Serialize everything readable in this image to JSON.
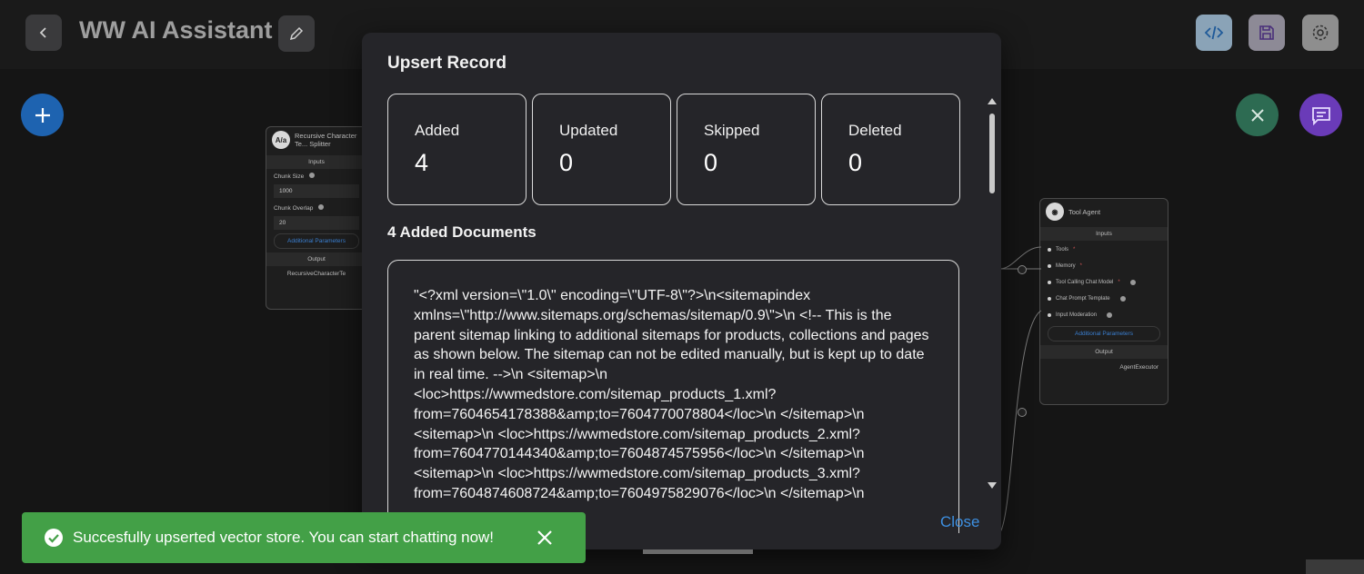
{
  "header": {
    "title": "WW AI Assistant",
    "icons": {
      "back": "chevron-left-icon",
      "edit": "pencil-icon",
      "code": "code-icon",
      "save": "save-icon",
      "settings": "gear-icon"
    }
  },
  "canvas": {
    "splitter_node": {
      "title": "Recursive Character Te... Splitter",
      "icon_text": "A/a",
      "inputs_label": "Inputs",
      "fields": [
        {
          "label": "Chunk Size",
          "value": "1000"
        },
        {
          "label": "Chunk Overlap",
          "value": "20"
        }
      ],
      "additional_params": "Additional Parameters",
      "output_label": "Output",
      "output_value": "RecursiveCharacterTe"
    },
    "agent_node": {
      "title": "Tool Agent",
      "inputs_label": "Inputs",
      "inputs": [
        {
          "label": "Tools",
          "required": "*"
        },
        {
          "label": "Memory",
          "required": "*"
        },
        {
          "label": "Tool Calling Chat Model",
          "required": "*"
        },
        {
          "label": "Chat Prompt Template",
          "required": ""
        },
        {
          "label": "Input Moderation",
          "required": ""
        }
      ],
      "additional_params": "Additional Parameters",
      "output_label": "Output",
      "output_value": "AgentExecutor"
    }
  },
  "dialog": {
    "title": "Upsert Record",
    "stats": [
      {
        "label": "Added",
        "value": "4"
      },
      {
        "label": "Updated",
        "value": "0"
      },
      {
        "label": "Skipped",
        "value": "0"
      },
      {
        "label": "Deleted",
        "value": "0"
      }
    ],
    "documents_title": "4 Added Documents",
    "document_text": "\"<?xml version=\\\"1.0\\\" encoding=\\\"UTF-8\\\"?>\\n<sitemapindex xmlns=\\\"http://www.sitemaps.org/schemas/sitemap/0.9\\\">\\n <!-- This is the parent sitemap linking to additional sitemaps for products, collections and pages as shown below. The sitemap can not be edited manually, but is kept up to date in real time. -->\\n <sitemap>\\n <loc>https://wwmedstore.com/sitemap_products_1.xml?from=7604654178388&amp;to=7604770078804</loc>\\n </sitemap>\\n <sitemap>\\n <loc>https://wwmedstore.com/sitemap_products_2.xml?from=7604770144340&amp;to=7604874575956</loc>\\n </sitemap>\\n <sitemap>\\n <loc>https://wwmedstore.com/sitemap_products_3.xml?from=7604874608724&amp;to=7604975829076</loc>\\n </sitemap>\\n",
    "close_label": "Close"
  },
  "toast": {
    "message": "Succesfully upserted vector store. You can start chatting now!",
    "color": "#43a047"
  }
}
